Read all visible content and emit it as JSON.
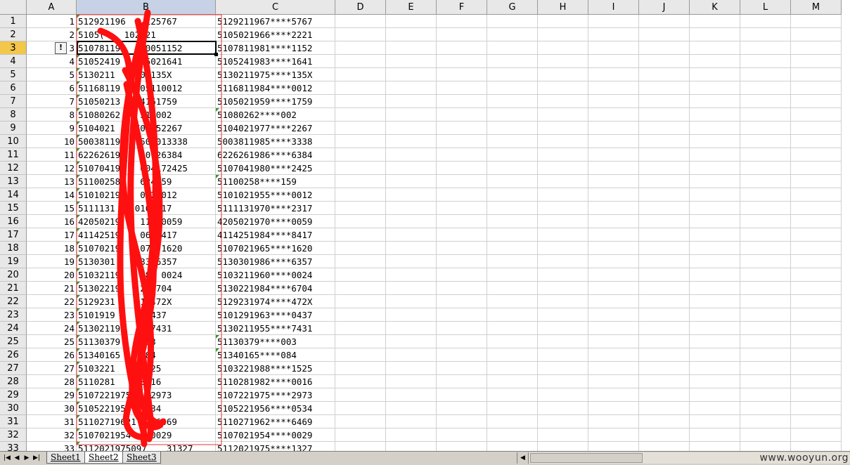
{
  "columns": [
    "A",
    "B",
    "C",
    "D",
    "E",
    "F",
    "G",
    "H",
    "I",
    "J",
    "K",
    "L",
    "M"
  ],
  "selected_column": "B",
  "selected_row": "3",
  "rows": [
    {
      "n": "1",
      "a": "1",
      "b": "51292119671125767",
      "c": "5129211967****5767"
    },
    {
      "n": "2",
      "a": "2",
      "b": "51050219660102221",
      "c": "5105021966****2221"
    },
    {
      "n": "3",
      "a": "3",
      "b": "51078119810051152",
      "c": "5107811981****1152"
    },
    {
      "n": "4",
      "a": "4",
      "b": "51052419830502164 1",
      "c": "5105241983****1641"
    },
    {
      "n": "5",
      "a": "5",
      "b": "5130211975201135X",
      "c": "5130211975****135X"
    },
    {
      "n": "6",
      "a": "6",
      "b": "51168119840511 0012",
      "c": "5116811984****0012"
    },
    {
      "n": "7",
      "a": "7",
      "b": "51050219590416175 9",
      "c": "5105021959****1759"
    },
    {
      "n": "8",
      "a": "8",
      "b": "510802620513002",
      "c": "51080262****002"
    },
    {
      "n": "9",
      "a": "9",
      "b": "51040219770125226 7",
      "c": "5104021977****2267"
    },
    {
      "n": "10",
      "a": "10",
      "b": "50038119850201333 8",
      "c": "5003811985****3338"
    },
    {
      "n": "11",
      "a": "11",
      "b": "62262619860612638 4",
      "c": "6226261986****6384"
    },
    {
      "n": "12",
      "a": "12",
      "b": "51070419800417242 5",
      "c": "5107041980****2425"
    },
    {
      "n": "13",
      "a": "13",
      "b": "511002580624159",
      "c": "51100258****159"
    },
    {
      "n": "14",
      "a": "14",
      "b": "51010219550802001 2",
      "c": "5101021955****0012"
    },
    {
      "n": "15",
      "a": "15",
      "b": "51111319700102231 7",
      "c": "5111131970****2317"
    },
    {
      "n": "16",
      "a": "16",
      "b": "42050219701110005 9",
      "c": "4205021970****0059"
    },
    {
      "n": "17",
      "a": "17",
      "b": "41142519840610841 7",
      "c": "4114251984****8417"
    },
    {
      "n": "18",
      "a": "18",
      "b": "51070219650710162 0",
      "c": "5107021965****1620"
    },
    {
      "n": "19",
      "a": "19",
      "b": "51303019860331635 7",
      "c": "5130301986****6357"
    },
    {
      "n": "20",
      "a": "20",
      "b": "51032119600800002 4",
      "c": "5103211960****0024"
    },
    {
      "n": "21",
      "a": "21",
      "b": "51302219841206670 4",
      "c": "5130221984****6704"
    },
    {
      "n": "22",
      "a": "22",
      "b": "5129231974111847 2X",
      "c": "5129231974****472X"
    },
    {
      "n": "23",
      "a": "23",
      "b": "51012919630815043 7",
      "c": "5101291963****0437"
    },
    {
      "n": "24",
      "a": "24",
      "b": "51302119551208743 1",
      "c": "5130211955****7431"
    },
    {
      "n": "25",
      "a": "25",
      "b": "511303791020003",
      "c": "51130379****003"
    },
    {
      "n": "26",
      "a": "26",
      "b": "513401651020084",
      "c": "51340165****084"
    },
    {
      "n": "27",
      "a": "27",
      "b": "51032219880914152 5",
      "c": "5103221988****1525"
    },
    {
      "n": "28",
      "a": "28",
      "b": "51102819820120001 6",
      "c": "5110281982****0016"
    },
    {
      "n": "29",
      "a": "29",
      "b": "51072219750212297 3",
      "c": "5107221975****2973"
    },
    {
      "n": "30",
      "a": "30",
      "b": "51052219561017053 4",
      "c": "5105221956****0534"
    },
    {
      "n": "31",
      "a": "31",
      "b": "51102719621217646 9",
      "c": "5110271962****6469"
    },
    {
      "n": "32",
      "a": "32",
      "b": "51070219540120002 9",
      "c": "5107021954****0029"
    },
    {
      "n": "33",
      "a": "33",
      "b": "51120219750931327",
      "c": "5112021975****1327"
    }
  ],
  "visible_b_text": [
    "512921196",
    "5105(",
    "510781198",
    "51052419",
    "5130211",
    "51168119",
    "51050213",
    "51080262",
    "5104021",
    "50038119",
    "62262619",
    "51070419",
    "51100258",
    "51010219",
    "5111131",
    "42050219",
    "41142519",
    "51070219",
    "5130301",
    "51032119",
    "51302219",
    "5129231",
    "5101919",
    "51302119",
    "51130379",
    "51340165",
    "5103221",
    "5110281",
    "5107221975",
    "510522195",
    "51102719621",
    "5107021954",
    "5112021975097"
  ],
  "visible_b_tail": [
    "125767",
    "102221",
    "0051152",
    "05021641",
    "201135X",
    "05110012",
    "4161759",
    "513002",
    "701252267",
    "502013338",
    "60126384",
    "004172425",
    "624159",
    "0820012",
    "0102317",
    "111 0059",
    "06 8417",
    "071 1620",
    "033 6357",
    "080 0024",
    "2 6704",
    "11 472X",
    "150437",
    "087431",
    "003",
    "084",
    "41525",
    "20016",
    "2973",
    "534",
    "6469",
    "0029",
    "31327"
  ],
  "sheet_tabs": [
    "Sheet1",
    "Sheet2",
    "Sheet3"
  ],
  "active_tab": "Sheet2",
  "nav_buttons": [
    "|◀",
    "◀",
    "▶",
    "▶|"
  ],
  "warning_icon_label": "!",
  "watermark": "www.wooyun.org"
}
